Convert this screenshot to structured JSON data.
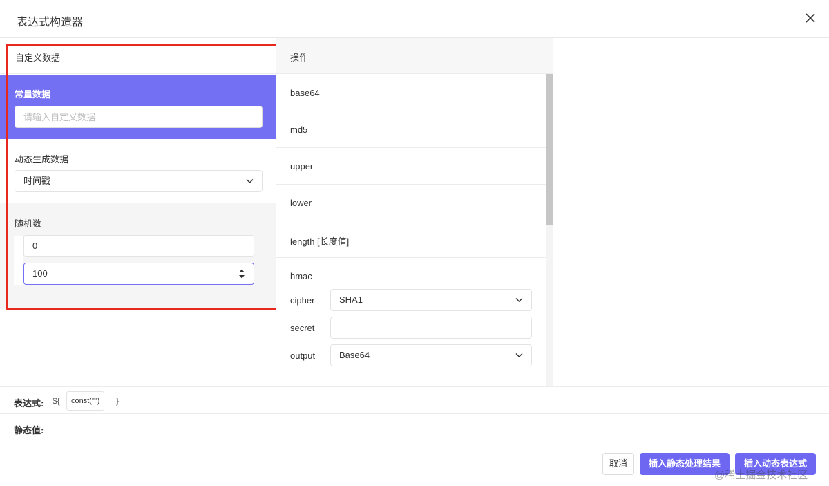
{
  "dialog": {
    "title": "表达式构造器"
  },
  "custom": {
    "header": "自定义数据",
    "constant": {
      "label": "常量数据",
      "placeholder": "请输入自定义数据",
      "value": ""
    },
    "dynamic": {
      "label": "动态生成数据",
      "selected": "时间戳"
    },
    "random": {
      "label": "随机数",
      "min": "0",
      "max": "100"
    }
  },
  "ops": {
    "header": "操作",
    "items": [
      "base64",
      "md5",
      "upper",
      "lower",
      "length [长度值]"
    ],
    "hmac": {
      "label": "hmac",
      "cipher_label": "cipher",
      "cipher_value": "SHA1",
      "secret_label": "secret",
      "secret_value": "",
      "output_label": "output",
      "output_value": "Base64"
    }
  },
  "expression": {
    "label": "表达式:",
    "open": "${",
    "token": "const(\"\")",
    "close": "}"
  },
  "static_value": {
    "label": "静态值:"
  },
  "buttons": {
    "cancel": "取消",
    "insert_static": "插入静态处理结果",
    "insert_dynamic": "插入动态表达式"
  },
  "watermark": "@稀土掘金技术社区",
  "colors": {
    "accent": "#7470f4",
    "highlight_frame": "#e8271e"
  }
}
